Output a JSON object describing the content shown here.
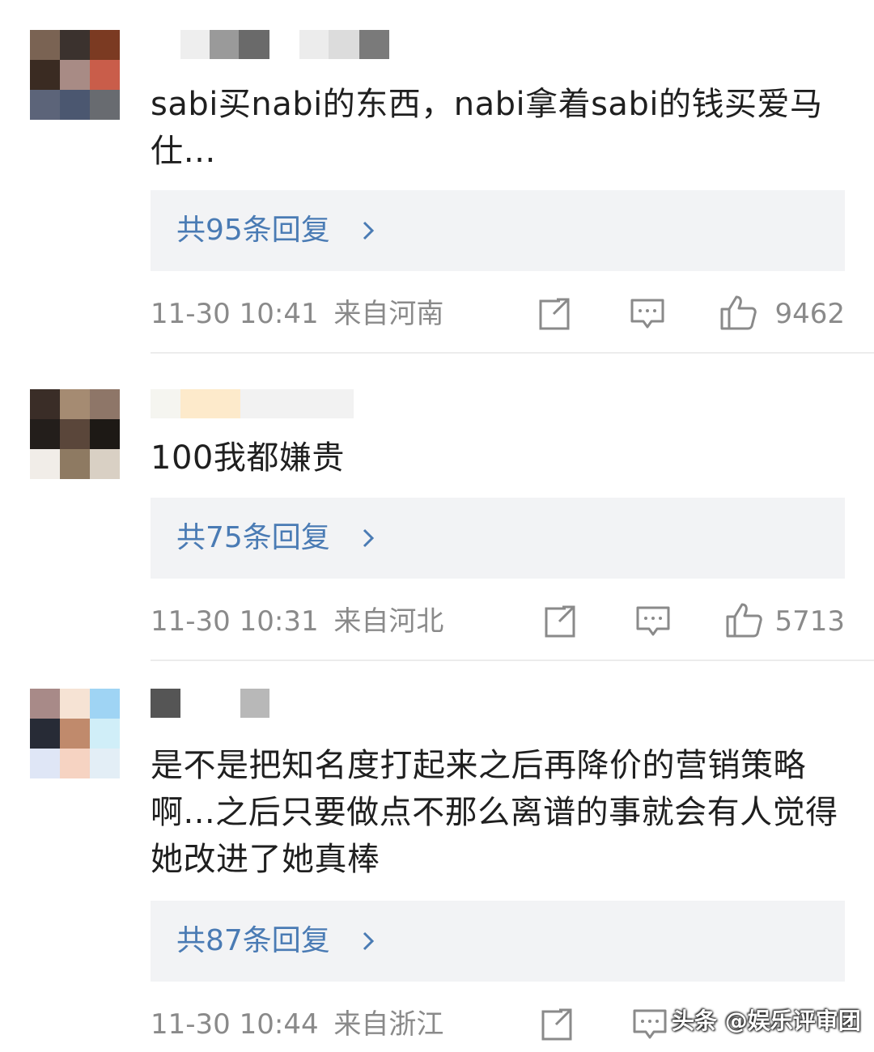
{
  "comments": [
    {
      "avatar_colors": [
        "#7a6353",
        "#3b322e",
        "#7b3a22",
        "#3a2b22",
        "#a88b85",
        "#c95d4a",
        "#5c6479",
        "#4b5770",
        "#686b70"
      ],
      "username_blocks": [
        "#eeeeee",
        "#9a9a9a",
        "#6a6a6a",
        "#ececec",
        "#dcdcdc",
        "#7a7a7a"
      ],
      "text": "sabi买nabi的东西，nabi拿着sabi的钱买爱马仕…",
      "reply_label": "共95条回复",
      "time": "11-30 10:41",
      "location": "来自河南",
      "likes": "9462"
    },
    {
      "avatar_colors": [
        "#3a2d27",
        "#a58b72",
        "#8e7668",
        "#231e1b",
        "#5a463a",
        "#1d1915",
        "#f1ede8",
        "#8e7a62",
        "#d9d0c4"
      ],
      "username_blocks": [
        "#f5f5f0",
        "#fdeacb",
        "#f2f2f2"
      ],
      "text": "100我都嫌贵",
      "reply_label": "共75条回复",
      "time": "11-30 10:31",
      "location": "来自河北",
      "likes": "5713"
    },
    {
      "avatar_colors": [
        "#a88a88",
        "#f6e3d4",
        "#9fd4f4",
        "#272b36",
        "#c08a6c",
        "#d0eef8",
        "#dfe6f6",
        "#f6d3c2",
        "#e3eef6"
      ],
      "username_blocks": [
        "#555555",
        "#b8b8b8"
      ],
      "text": "是不是把知名度打起来之后再降价的营销策略啊...之后只要做点不那么离谱的事就会有人觉得她改进了她真棒",
      "reply_label": "共87条回复",
      "time": "11-30 10:44",
      "location": "来自浙江",
      "likes": ""
    }
  ],
  "watermark": "头条 @娱乐评审团",
  "colors": {
    "link": "#4a7bb4",
    "meta": "#8a8a8a",
    "reply_bg": "#f2f3f5"
  },
  "icons": [
    "share-icon",
    "comment-icon",
    "like-icon",
    "chevron-right-icon"
  ]
}
